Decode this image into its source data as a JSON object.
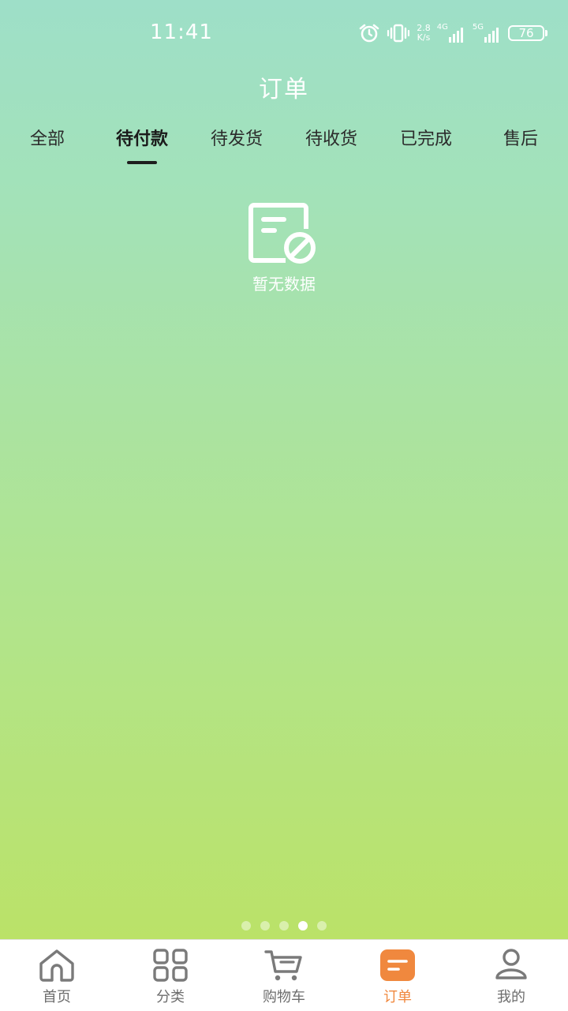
{
  "status_bar": {
    "time": "11:41",
    "net_speed_value": "2.8",
    "net_speed_unit": "K/s",
    "net1_label": "4G",
    "net2_label": "5G",
    "battery": "76"
  },
  "header": {
    "title": "订单"
  },
  "tabs": [
    {
      "label": "全部"
    },
    {
      "label": "待付款"
    },
    {
      "label": "待发货"
    },
    {
      "label": "待收货"
    },
    {
      "label": "已完成"
    },
    {
      "label": "售后"
    }
  ],
  "active_tab_index": 1,
  "empty_state": {
    "text": "暂无数据",
    "icon": "no-data-document-icon"
  },
  "pager": {
    "count": 5,
    "active_index": 3
  },
  "bottom_nav": [
    {
      "label": "首页",
      "icon": "home-icon"
    },
    {
      "label": "分类",
      "icon": "category-grid-icon"
    },
    {
      "label": "购物车",
      "icon": "cart-icon"
    },
    {
      "label": "订单",
      "icon": "order-icon"
    },
    {
      "label": "我的",
      "icon": "profile-icon"
    }
  ],
  "active_nav_index": 3,
  "colors": {
    "accent": "#f0883e",
    "tab_text": "#2b2b2b",
    "nav_text": "#6d6d6d"
  }
}
